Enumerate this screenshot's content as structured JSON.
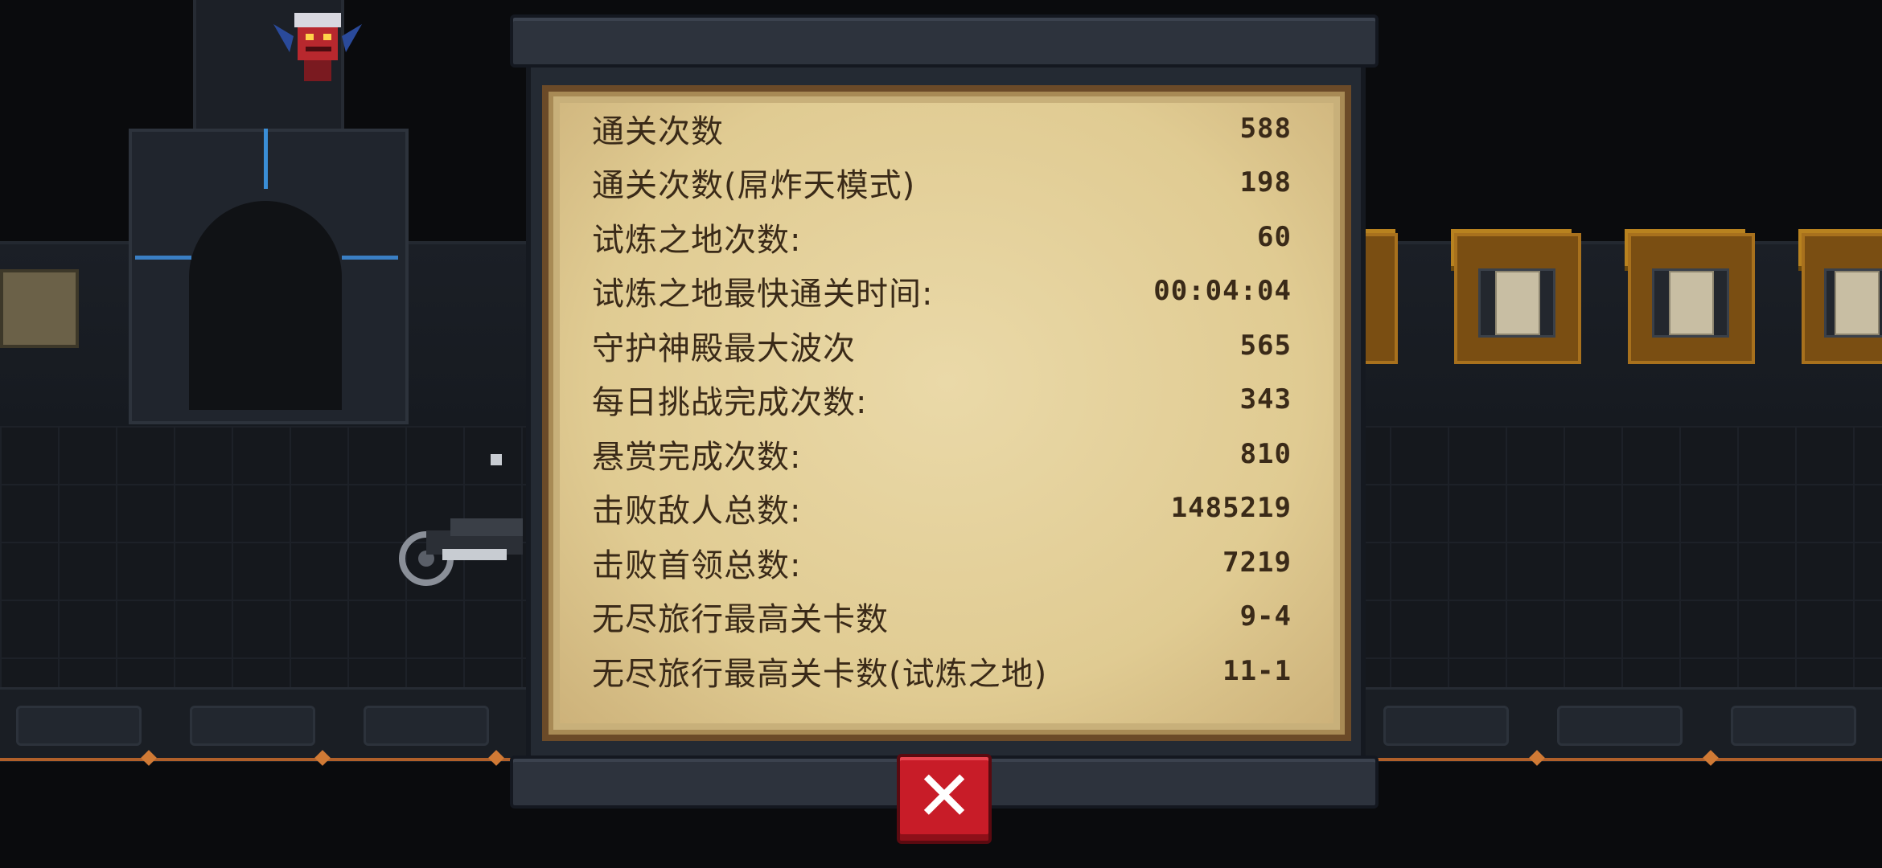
{
  "stats": [
    {
      "label": "通关次数",
      "value": "588"
    },
    {
      "label": "通关次数(屌炸天模式)",
      "value": "198"
    },
    {
      "label": "试炼之地次数:",
      "value": "60"
    },
    {
      "label": "试炼之地最快通关时间:",
      "value": "00:04:04"
    },
    {
      "label": "守护神殿最大波次",
      "value": "565"
    },
    {
      "label": "每日挑战完成次数:",
      "value": "343"
    },
    {
      "label": "悬赏完成次数:",
      "value": "810"
    },
    {
      "label": "击败敌人总数:",
      "value": "1485219"
    },
    {
      "label": "击败首领总数:",
      "value": "7219"
    },
    {
      "label": "无尽旅行最高关卡数",
      "value": "9-4"
    },
    {
      "label": "无尽旅行最高关卡数(试炼之地)",
      "value": "11-1"
    }
  ],
  "close_button": {
    "icon": "close-icon",
    "glyph": "✕"
  },
  "colors": {
    "parchment": "#e6d4a0",
    "text": "#3a2a18",
    "close_button": "#c81c28",
    "rail_accent": "#b0602a"
  }
}
